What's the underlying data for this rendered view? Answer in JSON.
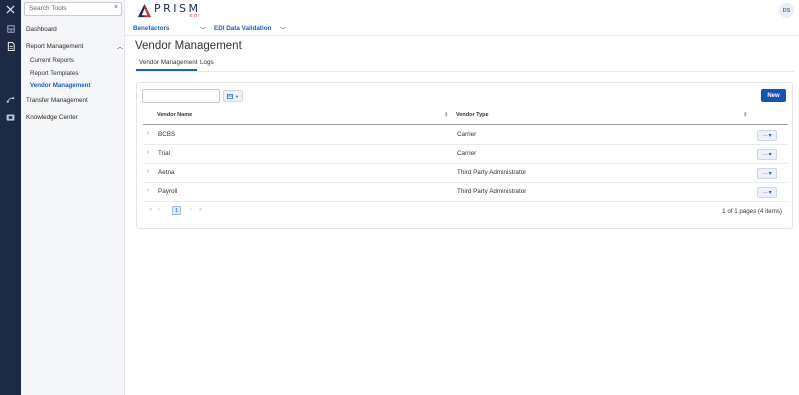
{
  "rail": {
    "icons": [
      "close-icon",
      "dashboard-icon",
      "report-icon",
      "transfer-icon",
      "knowledge-icon"
    ]
  },
  "sidebar": {
    "search_placeholder": "Search Tools",
    "clear_glyph": "×",
    "items": {
      "dashboard": "Dashboard",
      "report_management": "Report Management",
      "current_reports": "Current Reports",
      "report_templates": "Report Templates",
      "vendor_management": "Vendor Management",
      "transfer_management": "Transfer Management",
      "knowledge_center": "Knowledge Center"
    }
  },
  "header": {
    "logo_text": "PRISM",
    "logo_sub": "EDI",
    "avatar_initials": "DS",
    "benefactors": "Benefactors",
    "edi_validation": "EDI Data Validation"
  },
  "page": {
    "title": "Vendor Management",
    "tabs": [
      "Vendor Management",
      "Logs"
    ],
    "active_tab": "Vendor Management"
  },
  "table": {
    "new_button": "New",
    "columns": [
      "Vendor Name",
      "Vendor Type"
    ],
    "rows": [
      {
        "name": "BCBS",
        "type": "Carrier"
      },
      {
        "name": "Trial",
        "type": "Carrier"
      },
      {
        "name": "Aetna",
        "type": "Third Party Administrator"
      },
      {
        "name": "Payroll",
        "type": "Third Party Administrator"
      }
    ],
    "actions_glyph": "··· ▾",
    "current_page": "1",
    "pager_info": "1 of 1 pages (4 items)"
  },
  "colors": {
    "rail_bg": "#1d2a44",
    "accent": "#1f5fb8",
    "primary_button": "#1853b4"
  }
}
